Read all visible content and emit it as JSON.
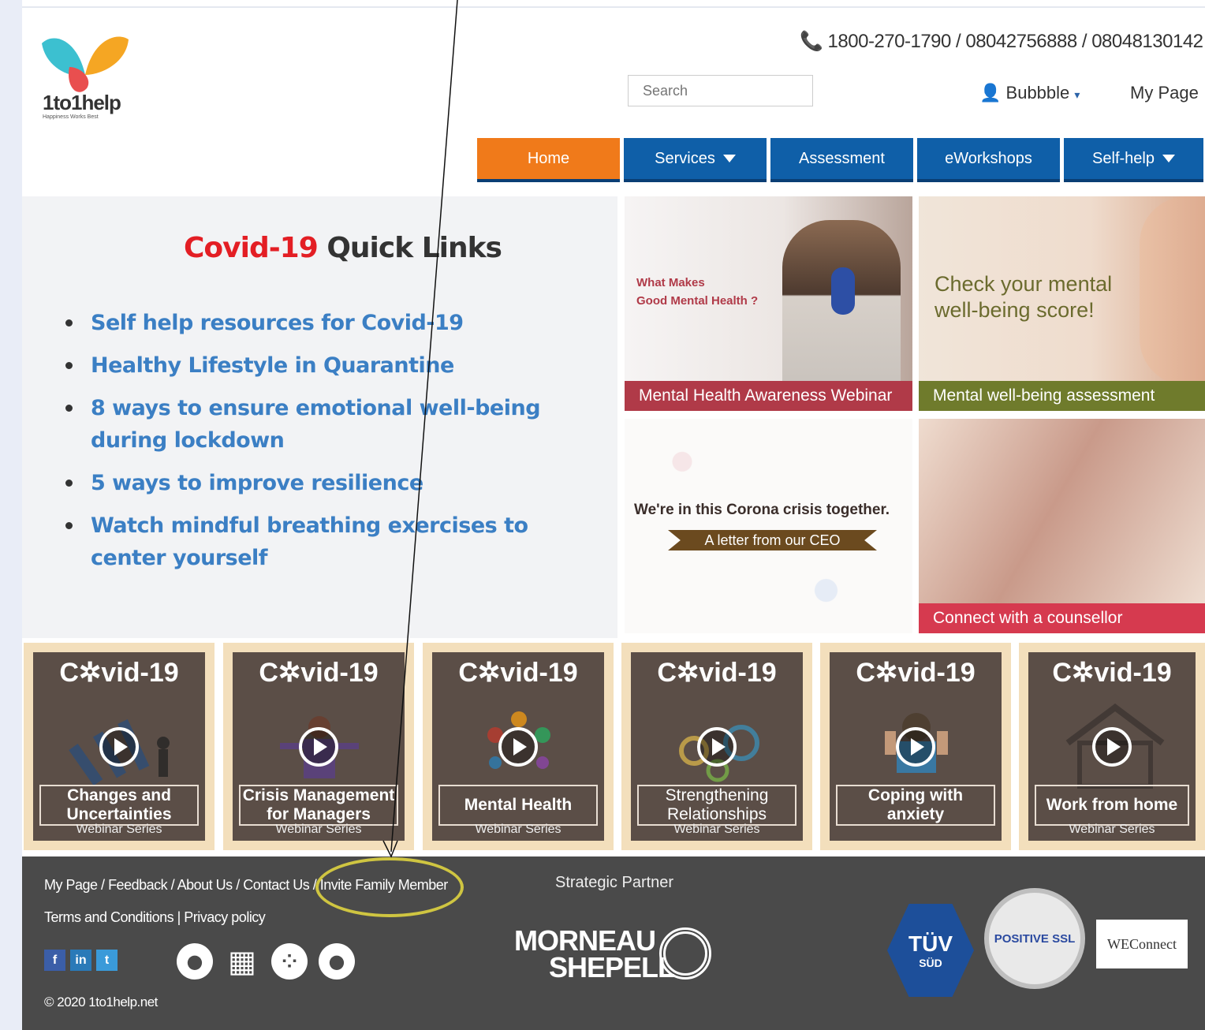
{
  "header": {
    "logo_text": "1to1help",
    "logo_tagline": "Happiness Works Best",
    "phone": "📞 1800-270-1790 / 08042756888 / 08048130142",
    "search_placeholder": "Search",
    "user_name": "Bubbble",
    "my_page": "My Page"
  },
  "nav": {
    "items": [
      {
        "label": "Home"
      },
      {
        "label": "Services"
      },
      {
        "label": "Assessment"
      },
      {
        "label": "eWorkshops"
      },
      {
        "label": "Self-help"
      }
    ]
  },
  "quick_links": {
    "title_red": "Covid-19",
    "title_rest": " Quick Links",
    "items": [
      "Self help resources for Covid-19",
      "Healthy Lifestyle in Quarantine",
      "8 ways to ensure emotional well-being during lockdown",
      "5 ways to improve resilience",
      "Watch mindful breathing exercises to center yourself"
    ]
  },
  "tiles": {
    "webinar": {
      "lead1": "What Makes",
      "lead2": "Good Mental Health ?",
      "caption": "Mental Health Awareness Webinar"
    },
    "assessment": {
      "lead1": "Check your mental",
      "lead2": "well-being score!",
      "caption": "Mental well-being assessment"
    },
    "ceo": {
      "lead": "We're in this Corona crisis together.",
      "ribbon": "A letter from our CEO"
    },
    "counsellor": {
      "caption": "Connect with a counsellor"
    }
  },
  "webinars": {
    "heading": "C✲vid-19",
    "series": "Webinar Series",
    "items": [
      {
        "label": "Changes and Uncertainties"
      },
      {
        "label": "Crisis Management for Managers"
      },
      {
        "label": "Mental Health"
      },
      {
        "label": "Strengthening Relationships"
      },
      {
        "label": "Coping with anxiety"
      },
      {
        "label": "Work from home"
      }
    ]
  },
  "footer": {
    "links": [
      "My Page",
      "Feedback",
      "About Us",
      "Contact Us",
      "Invite Family Member"
    ],
    "terms": "Terms and Conditions",
    "privacy": "Privacy policy",
    "copyright": "© 2020 1to1help.net",
    "partner_label": "Strategic Partner",
    "partner_line1": "MORNEAU",
    "partner_line2": "SHEPELL",
    "tuv_main": "TÜV",
    "tuv_sub": "SÜD",
    "ssl": "POSITIVE SSL",
    "wec": "WEConnect"
  },
  "colors": {
    "accent": "#f07a1a",
    "nav": "#0f5fa8",
    "link": "#3b7fc4",
    "footer": "#4a4a4a",
    "annotation": "#cfc541"
  }
}
